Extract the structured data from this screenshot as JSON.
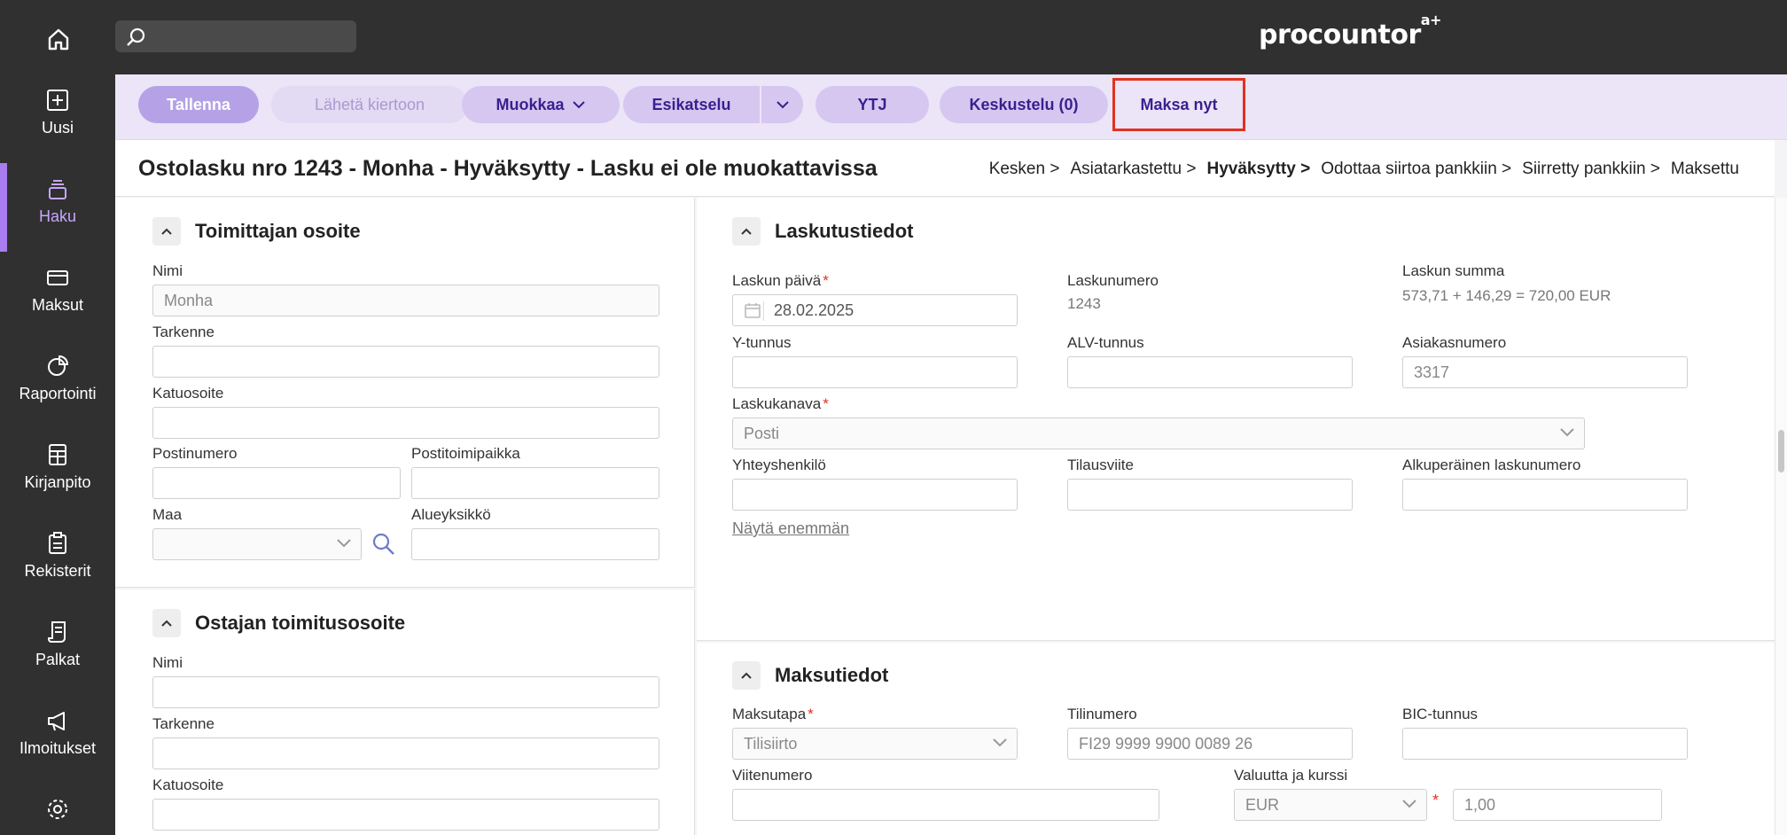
{
  "topbar": {
    "logo": "procountor",
    "logo_sup": "a+",
    "search_placeholder": ""
  },
  "sidebar": {
    "items": [
      {
        "label": "Uusi",
        "icon": "plus-square-icon"
      },
      {
        "label": "Haku",
        "icon": "stack-icon",
        "active": true
      },
      {
        "label": "Maksut",
        "icon": "card-icon"
      },
      {
        "label": "Raportointi",
        "icon": "pie-chart-icon"
      },
      {
        "label": "Kirjanpito",
        "icon": "ledger-icon"
      },
      {
        "label": "Rekisterit",
        "icon": "clipboard-icon"
      },
      {
        "label": "Palkat",
        "icon": "receipt-icon"
      },
      {
        "label": "Ilmoitukset",
        "icon": "megaphone-icon"
      },
      {
        "label": "",
        "icon": "gear-icon"
      }
    ]
  },
  "toolbar": {
    "save": "Tallenna",
    "send": "Lähetä kiertoon",
    "edit": "Muokkaa",
    "preview": "Esikatselu",
    "ytj": "YTJ",
    "discussion": "Keskustelu (0)",
    "pay_now": "Maksa nyt"
  },
  "header": {
    "title": "Ostolasku nro 1243 - Monha - Hyväksytty - Lasku ei ole muokattavissa",
    "breadcrumb": [
      "Kesken >",
      "Asiatarkastettu >",
      "Hyväksytty >",
      "Odottaa siirtoa pankkiin >",
      "Siirretty pankkiin >",
      "Maksettu"
    ]
  },
  "supplier": {
    "title": "Toimittajan osoite",
    "name_label": "Nimi",
    "name_value": "Monha",
    "spec_label": "Tarkenne",
    "street_label": "Katuosoite",
    "postal_label": "Postinumero",
    "city_label": "Postitoimipaikka",
    "country_label": "Maa",
    "region_label": "Alueyksikkö"
  },
  "buyer": {
    "title": "Ostajan toimitusosoite",
    "name_label": "Nimi",
    "spec_label": "Tarkenne",
    "street_label": "Katuosoite"
  },
  "invoice": {
    "title": "Laskutustiedot",
    "date_label": "Laskun päivä",
    "date_value": "28.02.2025",
    "number_label": "Laskunumero",
    "number_value": "1243",
    "sum_label": "Laskun summa",
    "sum_value": "573,71 + 146,29 = 720,00 EUR",
    "ytunnus_label": "Y-tunnus",
    "vat_label": "ALV-tunnus",
    "customer_no_label": "Asiakasnumero",
    "customer_no_value": "3317",
    "channel_label": "Laskukanava",
    "channel_value": "Posti",
    "contact_label": "Yhteyshenkilö",
    "order_ref_label": "Tilausviite",
    "orig_no_label": "Alkuperäinen laskunumero",
    "show_more": "Näytä enemmän"
  },
  "payment": {
    "title": "Maksutiedot",
    "method_label": "Maksutapa",
    "method_value": "Tilisiirto",
    "account_label": "Tilinumero",
    "account_value": "FI29 9999 9900 0089 26",
    "bic_label": "BIC-tunnus",
    "ref_label": "Viitenumero",
    "currency_label": "Valuutta ja kurssi",
    "currency_value": "EUR",
    "rate_value": "1,00"
  },
  "colors": {
    "accent": "#3a1f8f",
    "highlight": "#e0321f",
    "sidebar": "#303030",
    "toolbar": "#ece4f7"
  }
}
